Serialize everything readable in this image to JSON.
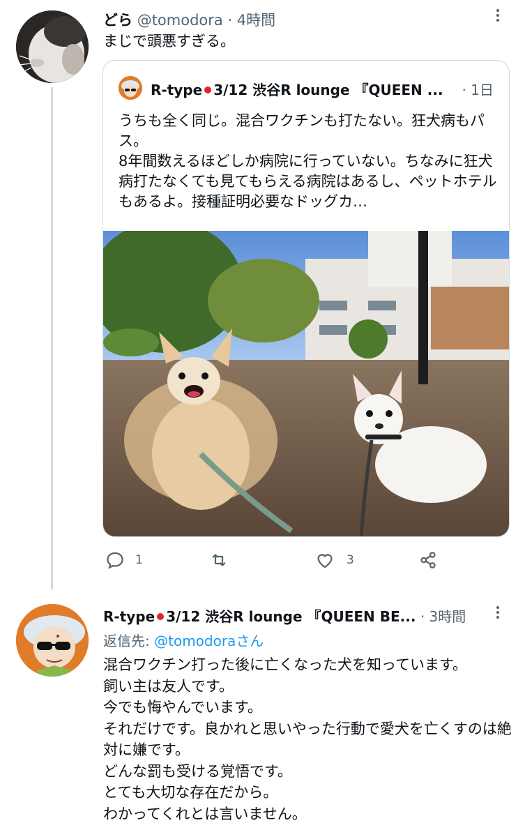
{
  "tweet1": {
    "display_name": "どら",
    "handle": "@tomodora",
    "time": "· 4時間",
    "text": "まじで頭悪すぎる。"
  },
  "quote": {
    "display_name_prefix": "R-type",
    "display_name_suffix": "3/12 渋谷R lounge 『QUEEN ...",
    "time": "· 1日",
    "text": "うちも全く同じ。混合ワクチンも打たない。狂犬病もパス。\n8年間数えるほどしか病院に行っていない。ちなみに狂犬病打たなくても見てもらえる病院はあるし、ペットホテルもあるよ。接種証明必要なドッグカ…"
  },
  "actions": {
    "reply_count": "1",
    "retweet_count": "",
    "like_count": "3"
  },
  "tweet2": {
    "display_name_prefix": "R-type",
    "display_name_suffix": "3/12 渋谷R lounge 『QUEEN BE...",
    "time": "· 3時間",
    "reply_to_label": "返信先: ",
    "reply_to_handle": "@tomodora",
    "reply_to_suffix": "さん",
    "text": "混合ワクチン打った後に亡くなった犬を知っています。\n飼い主は友人です。\n今でも悔やんでいます。\nそれだけです。良かれと思いやった行動で愛犬を亡くすのは絶対に嫌です。\nどんな罰も受ける覚悟です。\nとても大切な存在だから。\nわかってくれとは言いません。"
  },
  "colors": {
    "accent": "#1d9bf0",
    "muted": "#536471",
    "border": "#cfd9de"
  }
}
